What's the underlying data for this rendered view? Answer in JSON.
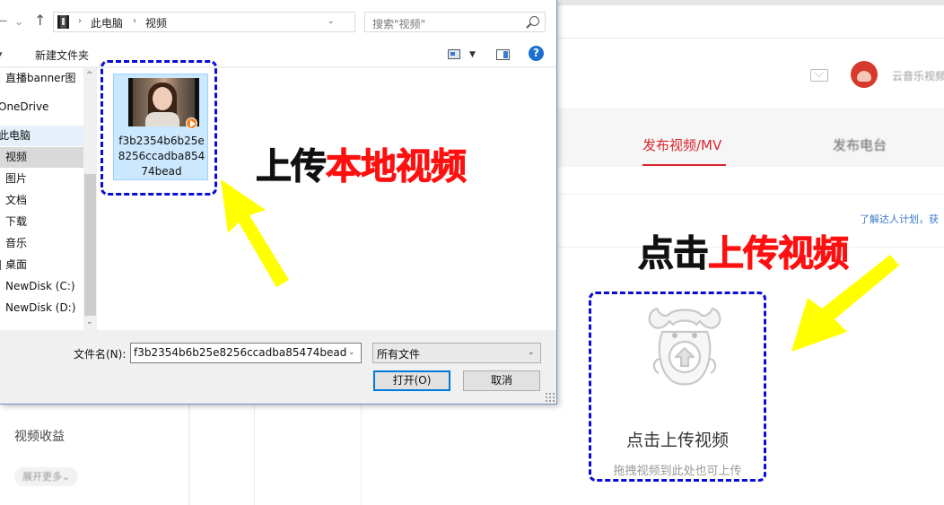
{
  "dialog": {
    "address": {
      "crumbs": [
        "此电脑",
        "视频"
      ]
    },
    "search_placeholder": "搜索\"视频\"",
    "toolbar": {
      "new_folder": "新建文件夹",
      "help": "?"
    },
    "nav_items": [
      {
        "label": "直播banner图",
        "state": "normal"
      },
      {
        "label": "OneDrive",
        "state": "normal"
      },
      {
        "label": "此电脑",
        "state": "selected"
      },
      {
        "label": "视频",
        "state": "current"
      },
      {
        "label": "图片",
        "state": "normal"
      },
      {
        "label": "文档",
        "state": "normal"
      },
      {
        "label": "下载",
        "state": "normal"
      },
      {
        "label": "音乐",
        "state": "normal"
      },
      {
        "label": "桌面",
        "state": "normal"
      },
      {
        "label": "NewDisk (C:)",
        "state": "normal"
      },
      {
        "label": "NewDisk (D:)",
        "state": "normal"
      }
    ],
    "file": {
      "name": "f3b2354b6b25e8256ccadba85474bead"
    },
    "filename_label": "文件名(N):",
    "filename_value": "f3b2354b6b25e8256ccadba85474bead",
    "filetype_value": "所有文件",
    "open_button": "打开(O)",
    "cancel_button": "取消"
  },
  "page": {
    "user_name": "云音乐视频",
    "tab_publish": "发布视频/MV",
    "tab_radio": "发布电台",
    "learn_link": "了解达人计划，获",
    "upload_label": "点击上传视频",
    "upload_hint": "拖拽视频到此处也可上传",
    "nav_revenue": "视频收益",
    "nav_more": "展开更多⌄"
  },
  "annotations": {
    "local_video": {
      "black": "上传",
      "red": "本地视频"
    },
    "click_upload": {
      "black": "点击",
      "red": "上传视频"
    },
    "colors": {
      "black": "#111111",
      "red": "#ff1010",
      "arrow": "#ffff00",
      "dash": "#0b0bd6"
    }
  },
  "icons": [
    "back-arrow-icon",
    "forward-arrow-icon",
    "up-arrow-icon",
    "folder-video-icon",
    "chevron-right-icon",
    "refresh-icon",
    "search-icon",
    "view-icon",
    "preview-pane-icon",
    "help-icon",
    "mail-icon",
    "play-badge-icon",
    "upload-mascot-icon"
  ]
}
